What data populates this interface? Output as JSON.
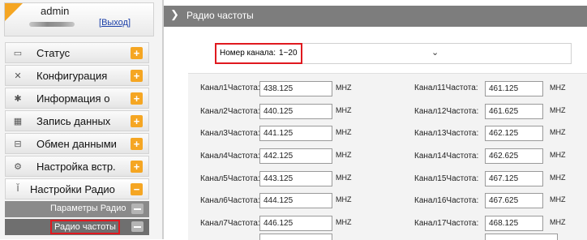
{
  "user": {
    "name": "admin",
    "logout_label": "Выход",
    "logout_open": "[",
    "logout_close": "]"
  },
  "sidebar": {
    "items": [
      {
        "label": "Статус",
        "icon": "monitor-icon",
        "glyph": "▭"
      },
      {
        "label": "Конфигурация",
        "icon": "tools-icon",
        "glyph": "✕"
      },
      {
        "label": "Информация о",
        "icon": "wrench-icon",
        "glyph": "✱"
      },
      {
        "label": "Запись данных",
        "icon": "calendar-icon",
        "glyph": "▦"
      },
      {
        "label": "Обмен данными",
        "icon": "computer-icon",
        "glyph": "⊟"
      },
      {
        "label": "Настройка встр.",
        "icon": "gear-icon",
        "glyph": "⚙"
      },
      {
        "label": "Настройки Радио",
        "icon": "antenna-icon",
        "glyph": "Ĭ"
      }
    ],
    "subitems": [
      {
        "label": "Параметры Радио"
      },
      {
        "label": "Радио частоты"
      }
    ]
  },
  "header": {
    "title": "Радио частоты",
    "chevron": "❯"
  },
  "channel_select": {
    "label": "Номер канала:",
    "value": "1~20"
  },
  "unit": "MHZ",
  "channels_left": [
    {
      "label": "Канал1Частота:",
      "value": "438.125"
    },
    {
      "label": "Канал2Частота:",
      "value": "440.125"
    },
    {
      "label": "Канал3Частота:",
      "value": "441.125"
    },
    {
      "label": "Канал4Частота:",
      "value": "442.125"
    },
    {
      "label": "Канал5Частота:",
      "value": "443.125"
    },
    {
      "label": "Канал6Частота:",
      "value": "444.125"
    },
    {
      "label": "Канал7Частота:",
      "value": "446.125"
    }
  ],
  "channels_right": [
    {
      "label": "Канал11Частота:",
      "value": "461.125"
    },
    {
      "label": "Канал12Частота:",
      "value": "461.625"
    },
    {
      "label": "Канал13Частота:",
      "value": "462.125"
    },
    {
      "label": "Канал14Частота:",
      "value": "462.625"
    },
    {
      "label": "Канал15Частота:",
      "value": "467.125"
    },
    {
      "label": "Канал16Частота:",
      "value": "467.625"
    },
    {
      "label": "Канал17Частота:",
      "value": "468.125"
    }
  ],
  "colors": {
    "accent": "#f5a623",
    "highlight": "#e0191f",
    "header": "#7d7d7d"
  }
}
